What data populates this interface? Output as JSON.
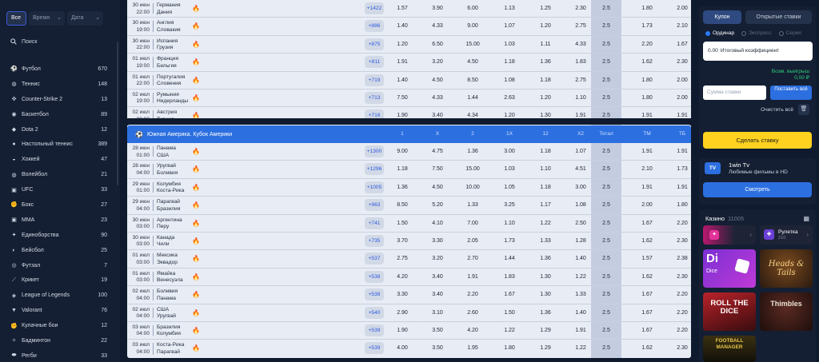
{
  "filters": {
    "all": "Все",
    "time": "Время",
    "date": "Дата"
  },
  "search": {
    "label": "Поиск"
  },
  "sports": [
    {
      "icon": "football-icon",
      "name": "Футбол",
      "count": "670"
    },
    {
      "icon": "tennis-icon",
      "name": "Теннис",
      "count": "148"
    },
    {
      "icon": "counter-strike-icon",
      "name": "Counter-Strike 2",
      "count": "13"
    },
    {
      "icon": "basketball-icon",
      "name": "Баскетбол",
      "count": "89"
    },
    {
      "icon": "dota-icon",
      "name": "Dota 2",
      "count": "12"
    },
    {
      "icon": "table-tennis-icon",
      "name": "Настольный теннис",
      "count": "389"
    },
    {
      "icon": "hockey-icon",
      "name": "Хоккей",
      "count": "47"
    },
    {
      "icon": "volleyball-icon",
      "name": "Волейбол",
      "count": "21"
    },
    {
      "icon": "ufc-icon",
      "name": "UFC",
      "count": "33"
    },
    {
      "icon": "boxing-icon",
      "name": "Бокс",
      "count": "27"
    },
    {
      "icon": "mma-icon",
      "name": "MMA",
      "count": "23"
    },
    {
      "icon": "martial-arts-icon",
      "name": "Единоборства",
      "count": "90"
    },
    {
      "icon": "baseball-icon",
      "name": "Бейсбол",
      "count": "25"
    },
    {
      "icon": "futsal-icon",
      "name": "Футзал",
      "count": "7"
    },
    {
      "icon": "cricket-icon",
      "name": "Крикет",
      "count": "19"
    },
    {
      "icon": "league-of-legends-icon",
      "name": "League of Legends",
      "count": "100"
    },
    {
      "icon": "valorant-icon",
      "name": "Valorant",
      "count": "76"
    },
    {
      "icon": "fist-fights-icon",
      "name": "Кулачные бои",
      "count": "12"
    },
    {
      "icon": "badminton-icon",
      "name": "Бадминтон",
      "count": "22"
    },
    {
      "icon": "rugby-icon",
      "name": "Регби",
      "count": "33"
    },
    {
      "icon": "golf-icon",
      "name": "Гольф",
      "count": "4"
    }
  ],
  "euro": {
    "matches": [
      {
        "date": "30 июн",
        "time": "22:00",
        "team1": "Германия",
        "team2": "Дания",
        "more": "+1422",
        "odds": [
          "1.57",
          "3.90",
          "6.00",
          "1.13",
          "1.25",
          "2.30",
          "2.5",
          "1.80",
          "2.00"
        ]
      },
      {
        "date": "30 июн",
        "time": "19:00",
        "team1": "Англия",
        "team2": "Словакия",
        "more": "+886",
        "odds": [
          "1.40",
          "4.33",
          "9.00",
          "1.07",
          "1.20",
          "2.75",
          "2.5",
          "1.73",
          "2.10"
        ]
      },
      {
        "date": "30 июн",
        "time": "22:00",
        "team1": "Испания",
        "team2": "Грузия",
        "more": "+875",
        "odds": [
          "1.20",
          "6.50",
          "15.00",
          "1.03",
          "1.11",
          "4.33",
          "2.5",
          "2.20",
          "1.67"
        ]
      },
      {
        "date": "01 июл",
        "time": "19:00",
        "team1": "Франция",
        "team2": "Бельгия",
        "more": "+811",
        "odds": [
          "1.91",
          "3.20",
          "4.50",
          "1.18",
          "1.36",
          "1.83",
          "2.5",
          "1.62",
          "2.30"
        ]
      },
      {
        "date": "01 июл",
        "time": "22:00",
        "team1": "Португалия",
        "team2": "Словения",
        "more": "+719",
        "odds": [
          "1.40",
          "4.50",
          "8.50",
          "1.08",
          "1.18",
          "2.75",
          "2.5",
          "1.80",
          "2.00"
        ]
      },
      {
        "date": "02 июл",
        "time": "19:00",
        "team1": "Румыния",
        "team2": "Нидерланды",
        "more": "+713",
        "odds": [
          "7.50",
          "4.33",
          "1.44",
          "2.63",
          "1.20",
          "1.10",
          "2.5",
          "1.80",
          "2.00"
        ]
      },
      {
        "date": "02 июл",
        "time": "22:00",
        "team1": "Австрия",
        "team2": "Турция",
        "more": "+716",
        "odds": [
          "1.90",
          "3.40",
          "4.34",
          "1.20",
          "1.30",
          "1.91",
          "2.5",
          "1.91",
          "1.91"
        ]
      }
    ]
  },
  "copa": {
    "title": "Южная Америка. Кубок Америки",
    "cols": [
      "1",
      "X",
      "2",
      "1X",
      "12",
      "X2",
      "Тотал",
      "ТМ",
      "ТБ"
    ],
    "matches": [
      {
        "date": "28 июн",
        "time": "01:00",
        "team1": "Панама",
        "team2": "США",
        "more": "+1300",
        "odds": [
          "9.00",
          "4.75",
          "1.36",
          "3.00",
          "1.18",
          "1.07",
          "2.5",
          "1.91",
          "1.91"
        ]
      },
      {
        "date": "28 июн",
        "time": "04:00",
        "team1": "Уругвай",
        "team2": "Боливия",
        "more": "+1296",
        "odds": [
          "1.18",
          "7.50",
          "15.00",
          "1.03",
          "1.10",
          "4.51",
          "2.5",
          "2.10",
          "1.73"
        ]
      },
      {
        "date": "29 июн",
        "time": "01:00",
        "team1": "Колумбия",
        "team2": "Коста-Рика",
        "more": "+1005",
        "odds": [
          "1.36",
          "4.50",
          "10.00",
          "1.05",
          "1.18",
          "3.00",
          "2.5",
          "1.91",
          "1.91"
        ]
      },
      {
        "date": "29 июн",
        "time": "04:00",
        "team1": "Парагвай",
        "team2": "Бразилия",
        "more": "+963",
        "odds": [
          "8.50",
          "5.20",
          "1.33",
          "3.25",
          "1.17",
          "1.08",
          "2.5",
          "2.00",
          "1.80"
        ]
      },
      {
        "date": "30 июн",
        "time": "03:00",
        "team1": "Аргентина",
        "team2": "Перу",
        "more": "+741",
        "odds": [
          "1.50",
          "4.10",
          "7.00",
          "1.10",
          "1.22",
          "2.50",
          "2.5",
          "1.67",
          "2.20"
        ]
      },
      {
        "date": "30 июн",
        "time": "03:00",
        "team1": "Канада",
        "team2": "Чили",
        "more": "+735",
        "odds": [
          "3.70",
          "3.30",
          "2.05",
          "1.73",
          "1.33",
          "1.28",
          "2.5",
          "1.62",
          "2.30"
        ]
      },
      {
        "date": "01 июл",
        "time": "03:00",
        "team1": "Мексика",
        "team2": "Эквадор",
        "more": "+537",
        "odds": [
          "2.75",
          "3.20",
          "2.70",
          "1.44",
          "1.36",
          "1.40",
          "2.5",
          "1.57",
          "2.38"
        ]
      },
      {
        "date": "01 июл",
        "time": "03:00",
        "team1": "Ямайка",
        "team2": "Венесуэла",
        "more": "+538",
        "odds": [
          "4.20",
          "3.40",
          "1.91",
          "1.83",
          "1.30",
          "1.22",
          "2.5",
          "1.62",
          "2.30"
        ]
      },
      {
        "date": "02 июл",
        "time": "04:00",
        "team1": "Боливия",
        "team2": "Панама",
        "more": "+538",
        "odds": [
          "3.30",
          "3.40",
          "2.20",
          "1.67",
          "1.30",
          "1.33",
          "2.5",
          "1.67",
          "2.20"
        ]
      },
      {
        "date": "02 июл",
        "time": "04:00",
        "team1": "США",
        "team2": "Уругвай",
        "more": "+540",
        "odds": [
          "2.90",
          "3.10",
          "2.60",
          "1.50",
          "1.36",
          "1.40",
          "2.5",
          "1.67",
          "2.20"
        ]
      },
      {
        "date": "03 июл",
        "time": "04:00",
        "team1": "Бразилия",
        "team2": "Колумбия",
        "more": "+539",
        "odds": [
          "1.90",
          "3.50",
          "4.20",
          "1.22",
          "1.29",
          "1.91",
          "2.5",
          "1.67",
          "2.20"
        ]
      },
      {
        "date": "03 июл",
        "time": "04:00",
        "team1": "Коста-Рика",
        "team2": "Парагвай",
        "more": "+539",
        "odds": [
          "4.00",
          "3.50",
          "1.95",
          "1.80",
          "1.29",
          "1.22",
          "2.5",
          "1.62",
          "2.30"
        ]
      }
    ]
  },
  "coupon": {
    "tab_coupon": "Купон",
    "tab_open": "Открытые ставки",
    "radio_single": "Ординар",
    "radio_express": "Экспресс",
    "radio_system": "Серия",
    "coef_value": "0.00",
    "coef_label": "Итоговый коэффициент",
    "win_label": "Возм. выигрыш",
    "win_value": "0,00 ₽",
    "stake_placeholder": "Сумма ставки",
    "stake_all": "Поставить всё",
    "clear_all": "Очистить всё",
    "make_bet": "Сделать ставку"
  },
  "tv": {
    "logo": "TV",
    "title": "1win Tv",
    "subtitle": "Любимые фильмы в HD",
    "watch": "Смотреть"
  },
  "casino": {
    "title": "Казино",
    "count": "11005",
    "roulette": "Рулетка",
    "roulette_count": "210",
    "dice_big": "Di",
    "dice_label": "Dice",
    "heads_tails": "Heads & Tails",
    "roll_dice": "ROLL THE DICE",
    "thimbles": "Thimbles",
    "football_manager": "FOOTBALL MANAGER"
  }
}
